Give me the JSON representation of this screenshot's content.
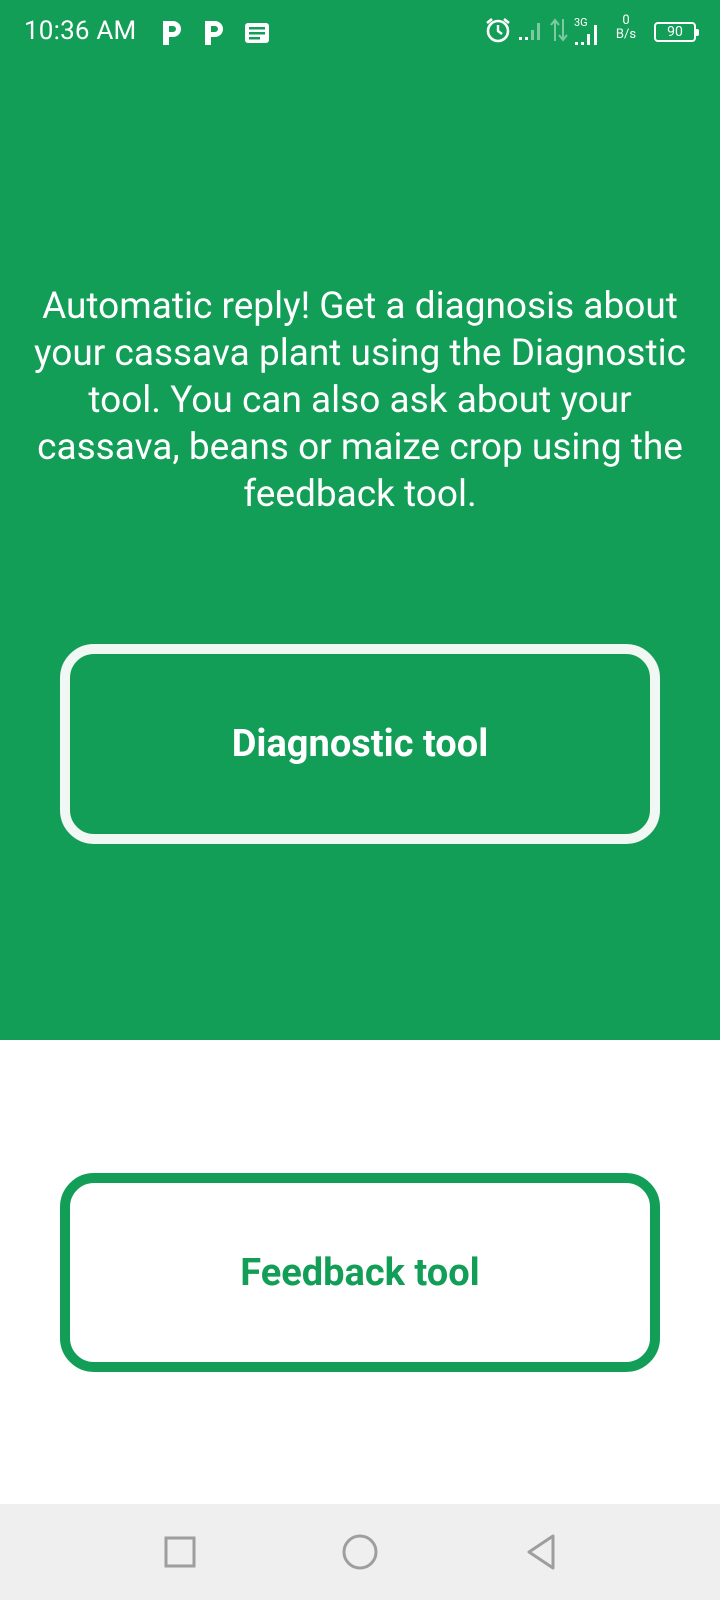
{
  "status_bar": {
    "time": "10:36 AM",
    "network_type": "3G",
    "data_rate_value": "0",
    "data_rate_unit": "B/s",
    "battery_level": "90"
  },
  "content": {
    "message": "Automatic reply! Get a diagnosis about your cassava plant using the Diagnostic tool. You can also ask about your cassava, beans or maize crop using the feedback tool.",
    "diagnostic_button_label": "Diagnostic tool",
    "feedback_button_label": "Feedback tool"
  },
  "colors": {
    "brand_green": "#129e57",
    "nav_background": "#efefef",
    "white": "#ffffff"
  },
  "icons": {
    "status_left": [
      "p-notification-icon",
      "p-notification-icon",
      "message-notification-icon"
    ],
    "status_right": [
      "alarm-icon",
      "signal-icon",
      "data-transfer-icon",
      "signal-3g-icon",
      "data-rate",
      "battery-icon"
    ],
    "nav": [
      "recents-square-icon",
      "home-circle-icon",
      "back-triangle-icon"
    ]
  }
}
